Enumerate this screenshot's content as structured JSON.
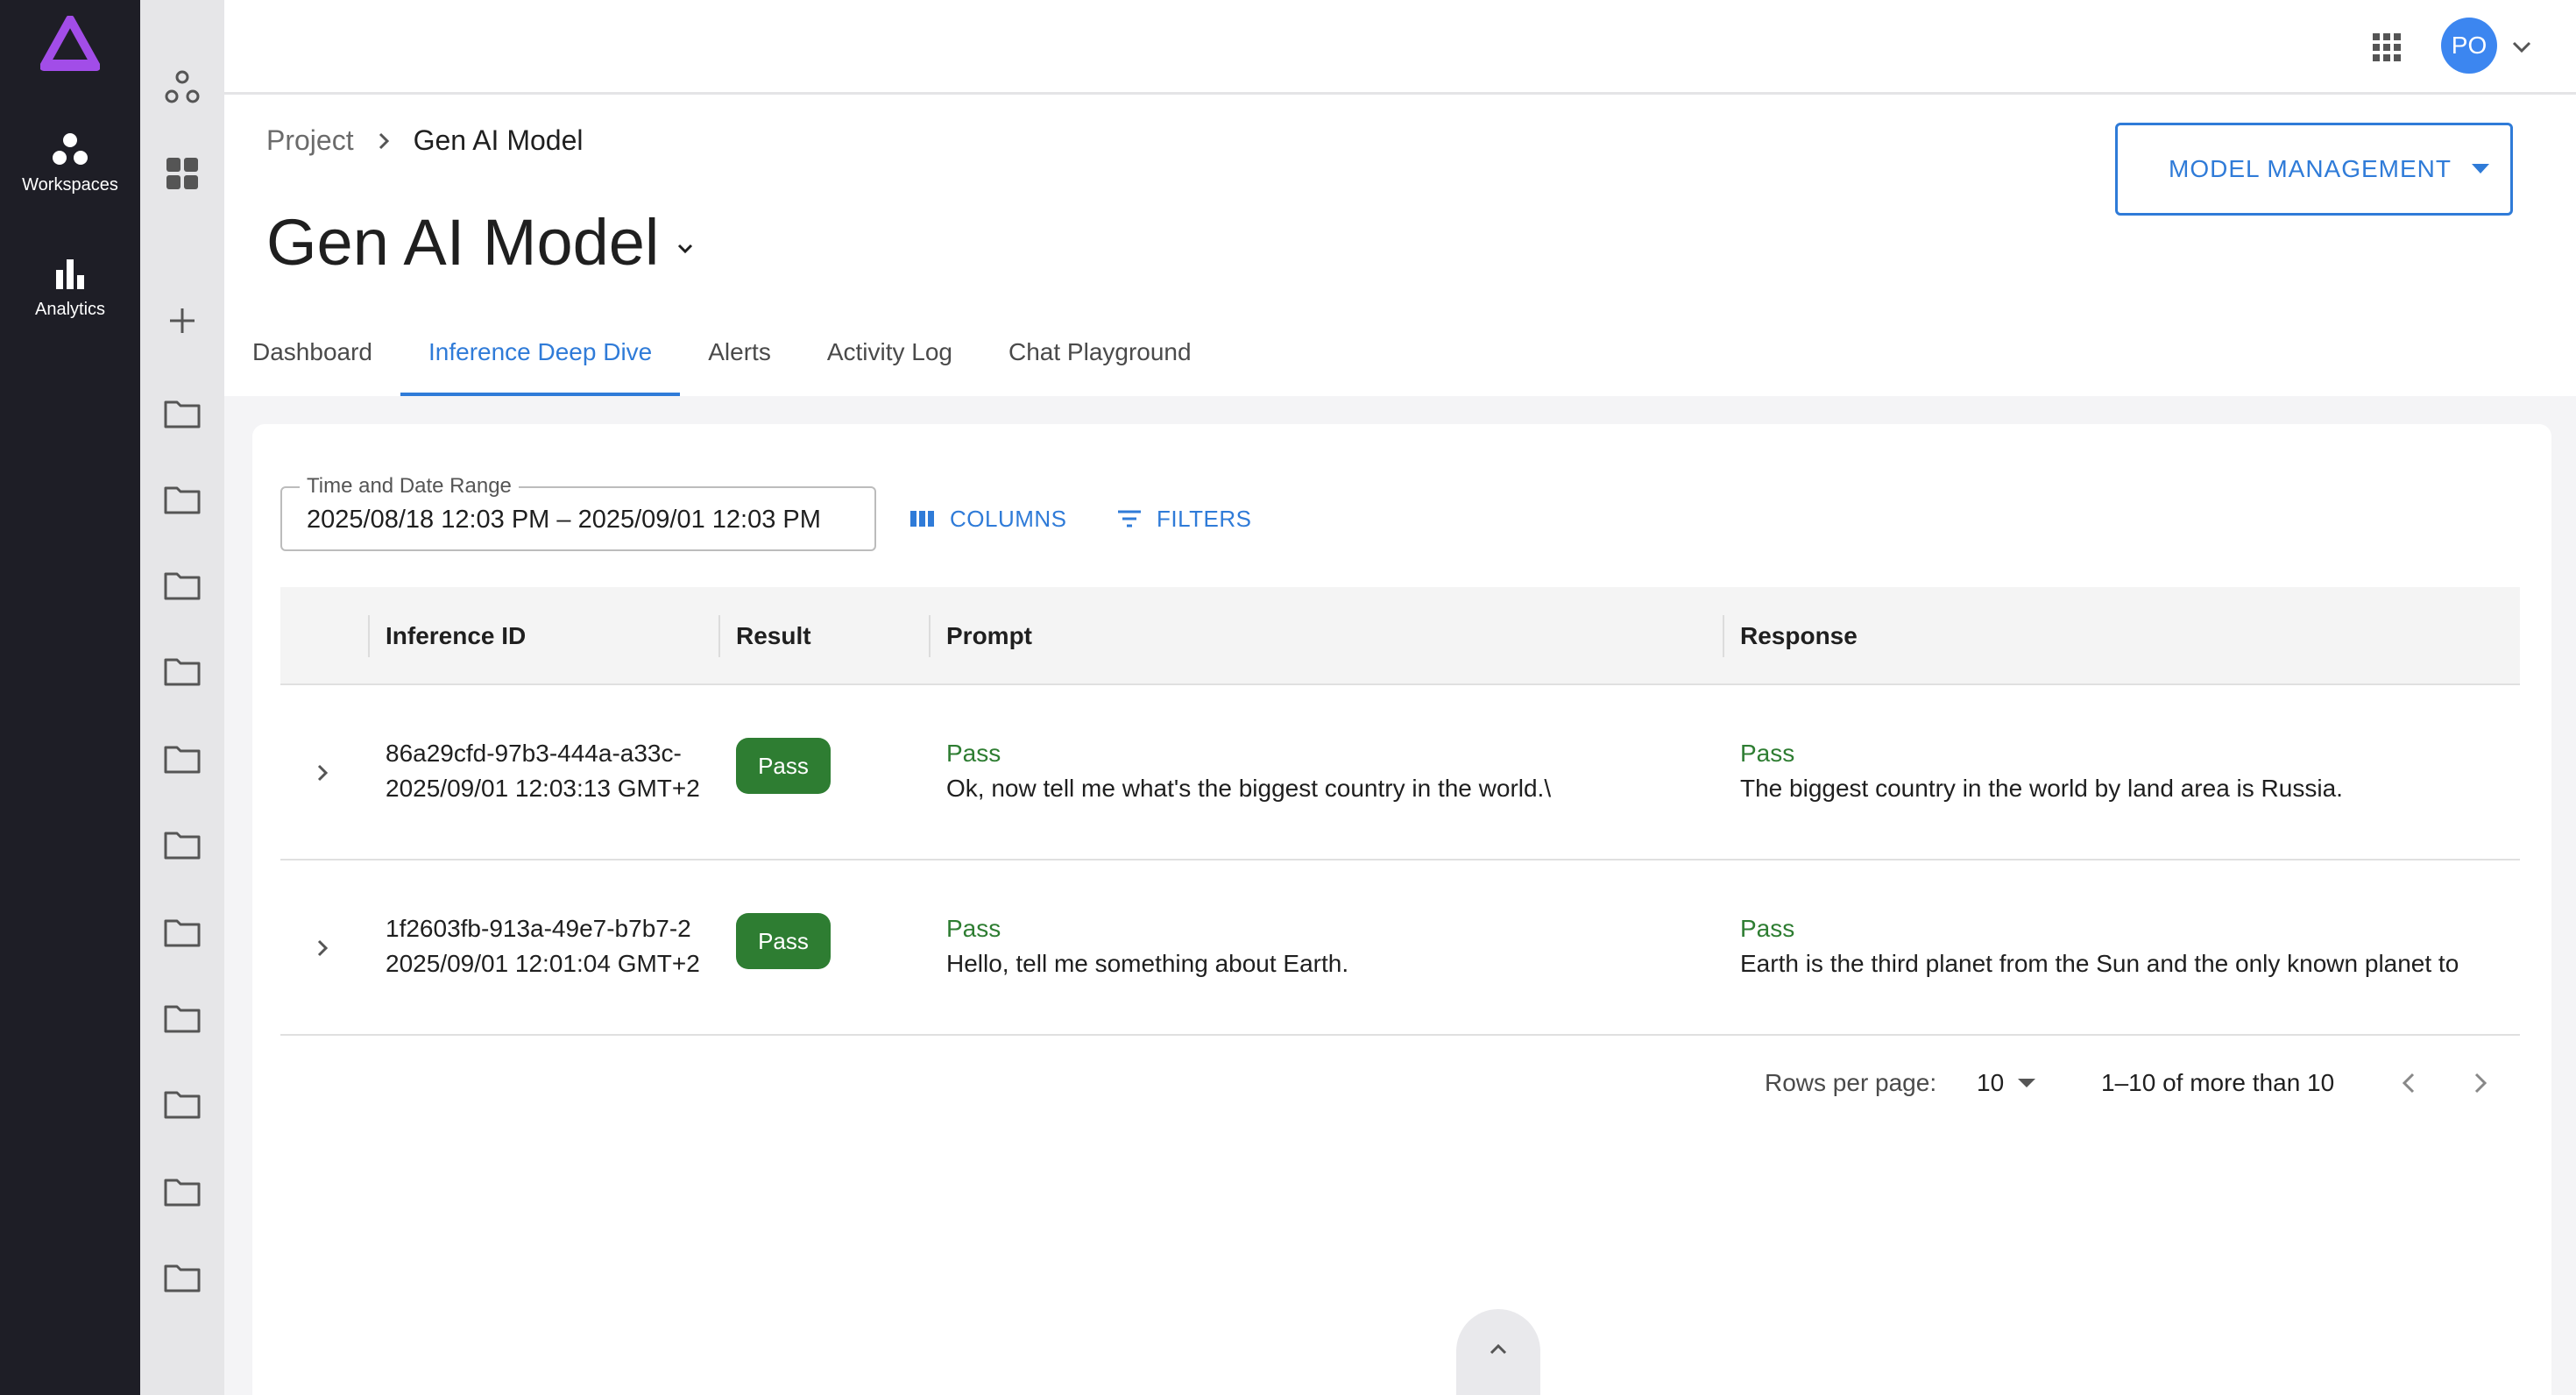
{
  "rail": {
    "items": [
      {
        "label": "Workspaces",
        "icon": "workspaces-icon"
      },
      {
        "label": "Analytics",
        "icon": "analytics-icon"
      }
    ],
    "accent": "#a24de8"
  },
  "topbar": {
    "avatar_initials": "PO"
  },
  "breadcrumb": {
    "root": "Project",
    "current": "Gen AI Model"
  },
  "page": {
    "title": "Gen AI Model"
  },
  "model_management": {
    "label": "MODEL MANAGEMENT"
  },
  "tabs": [
    {
      "label": "Dashboard",
      "active": false
    },
    {
      "label": "Inference Deep Dive",
      "active": true
    },
    {
      "label": "Alerts",
      "active": false
    },
    {
      "label": "Activity Log",
      "active": false
    },
    {
      "label": "Chat Playground",
      "active": false
    }
  ],
  "toolbar": {
    "date_label": "Time and Date Range",
    "date_value": "2025/08/18 12:03 PM – 2025/09/01 12:03 PM",
    "columns_label": "COLUMNS",
    "filters_label": "FILTERS"
  },
  "table": {
    "columns": [
      "Inference ID",
      "Result",
      "Prompt",
      "Response"
    ],
    "rows": [
      {
        "id": "86a29cfd-97b3-444a-a33c-",
        "timestamp": "2025/09/01 12:03:13 GMT+2",
        "result": "Pass",
        "prompt_status": "Pass",
        "prompt": "Ok, now tell me what's the biggest country in the world.\\",
        "response_status": "Pass",
        "response": "The biggest country in the world by land area is Russia."
      },
      {
        "id": "1f2603fb-913a-49e7-b7b7-2",
        "timestamp": "2025/09/01 12:01:04 GMT+2",
        "result": "Pass",
        "prompt_status": "Pass",
        "prompt": "Hello, tell me something about Earth.",
        "response_status": "Pass",
        "response": "Earth is the third planet from the Sun and the only known planet to"
      }
    ]
  },
  "pagination": {
    "rows_per_page_label": "Rows per page:",
    "rows_per_page_value": "10",
    "range_text": "1–10 of more than 10"
  },
  "colors": {
    "primary": "#2f7bd8",
    "pass_green": "#2e7d32",
    "rail_dark": "#1e1e26"
  }
}
